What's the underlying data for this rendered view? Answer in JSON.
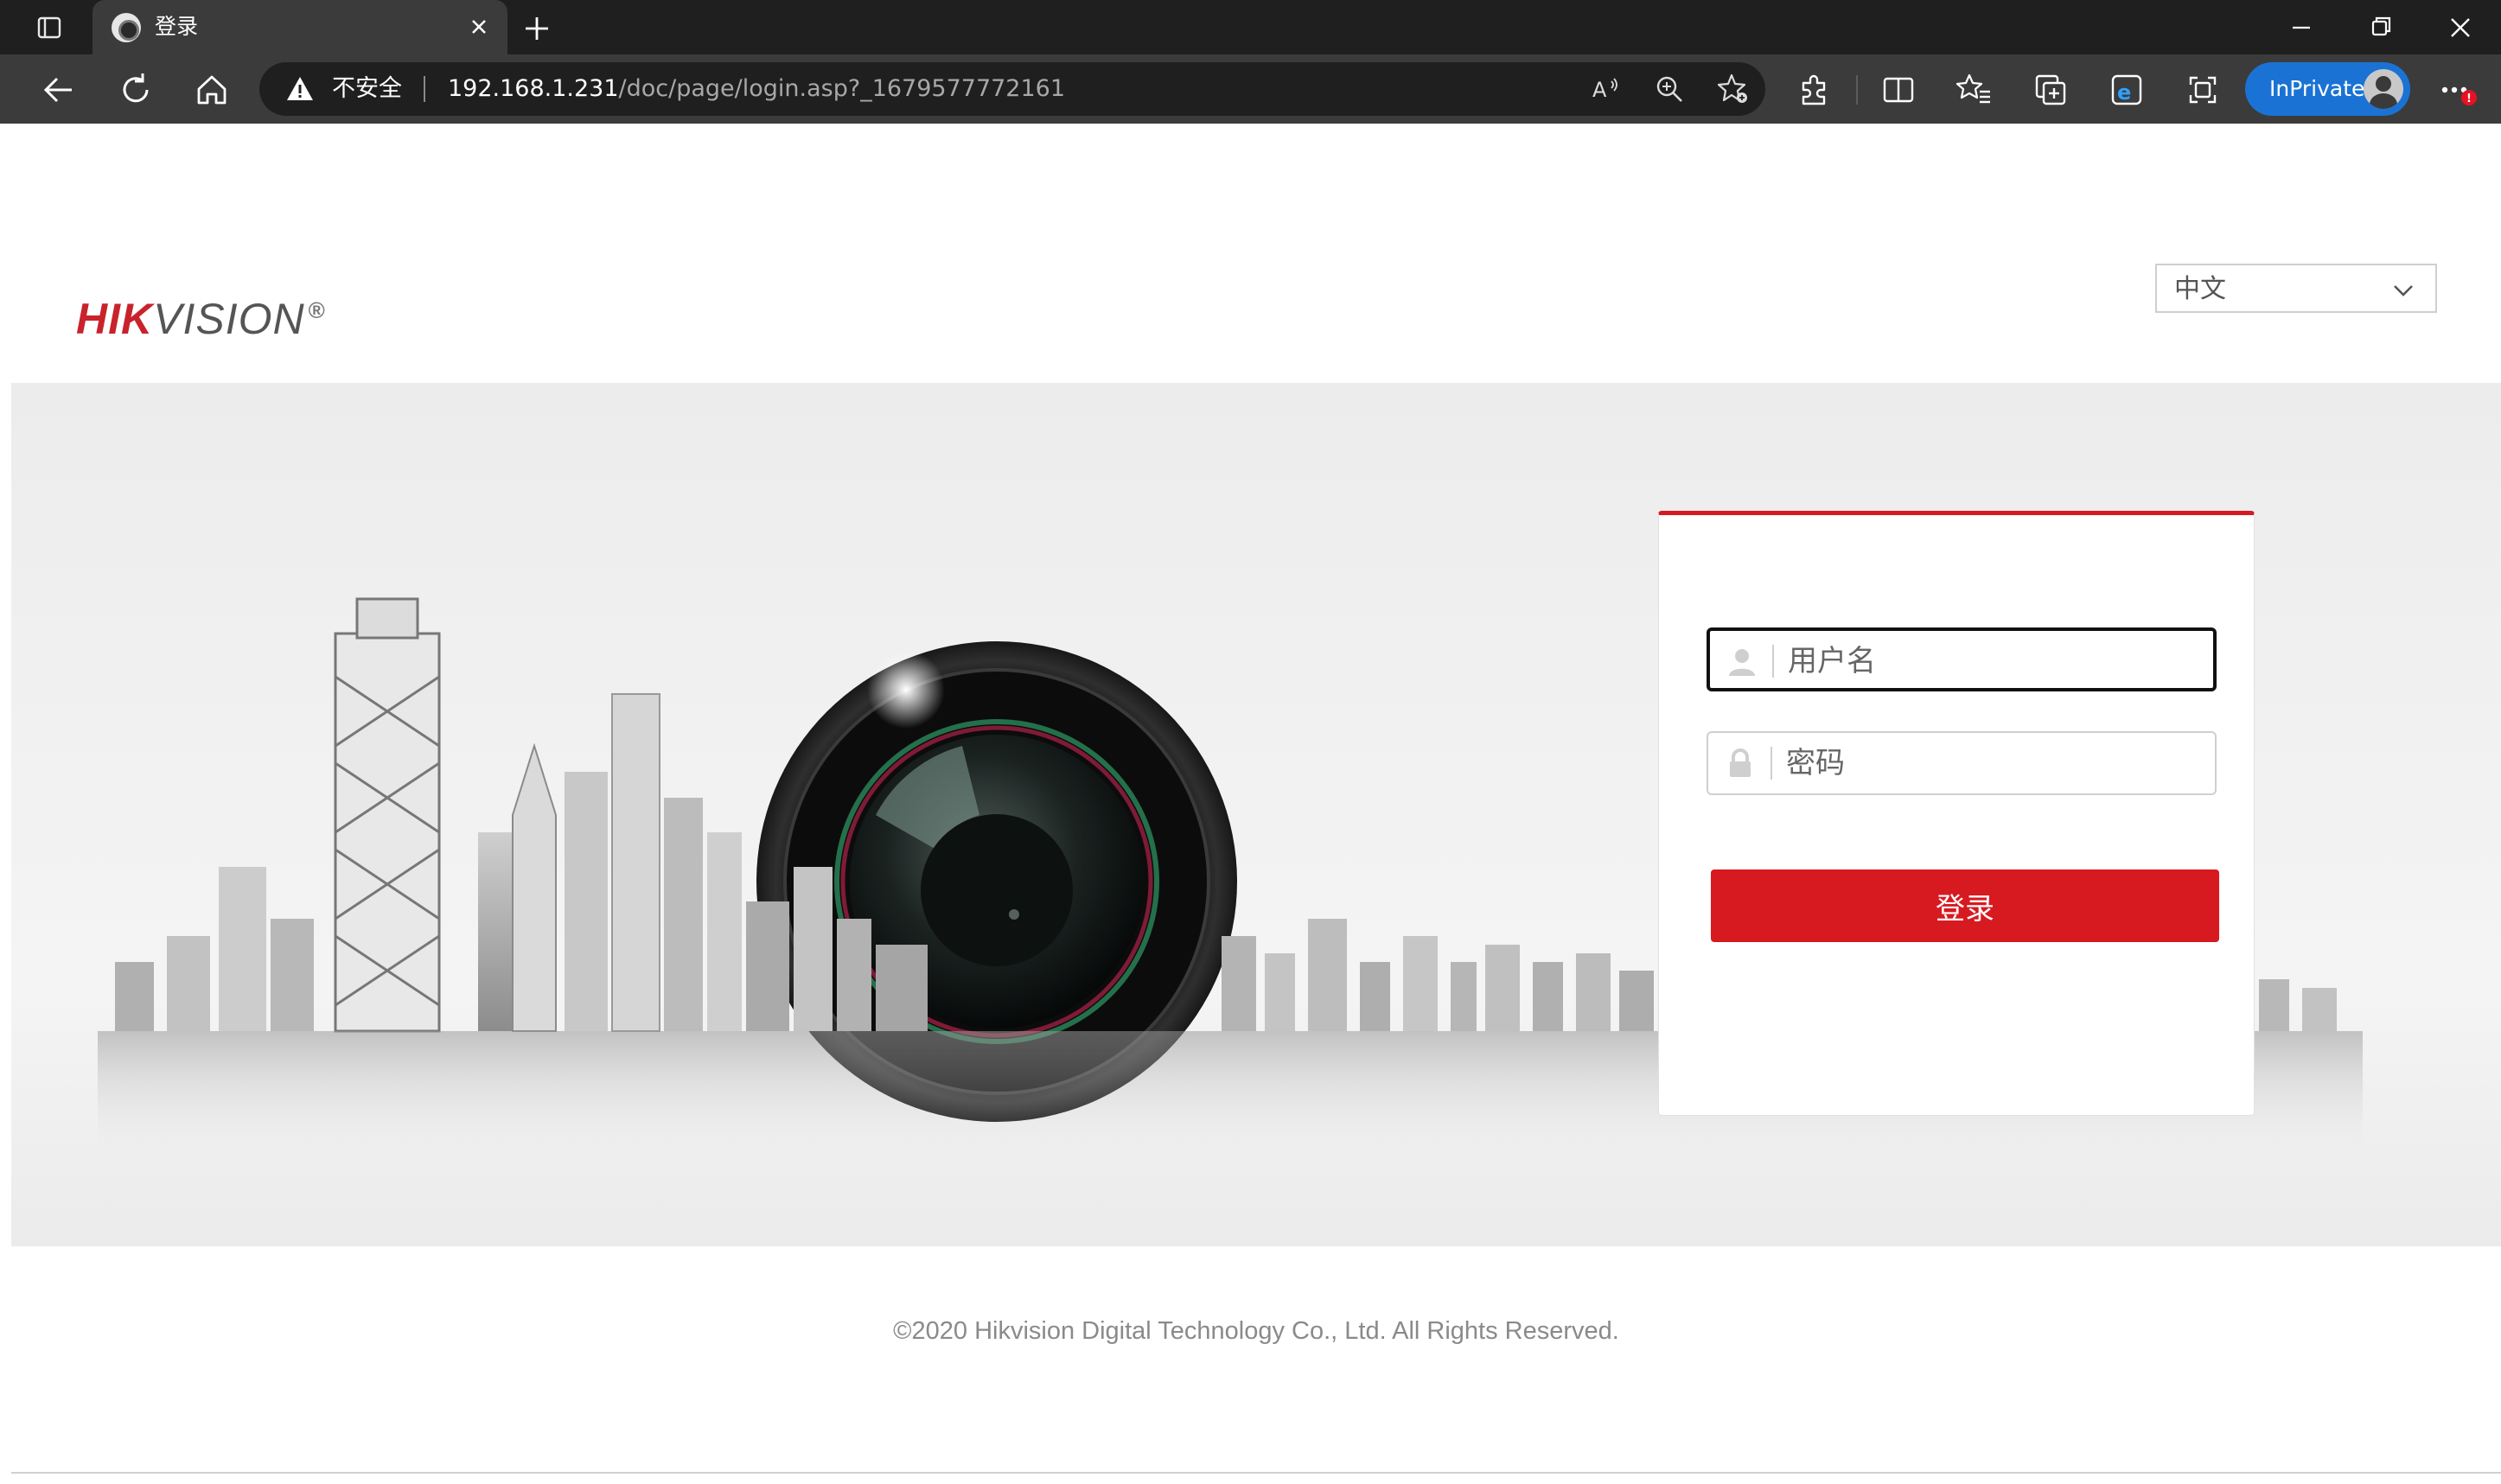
{
  "browser": {
    "tab": {
      "title": "登录",
      "favicon": "hikvision-favicon"
    },
    "address": {
      "security_label": "不安全",
      "url_host": "192.168.1.231",
      "url_path": "/doc/page/login.asp?_1679577772161"
    },
    "inprivate_label": "InPrivate",
    "icons": {
      "tab_actions": "tab-actions-icon",
      "new_tab": "plus-icon",
      "minimize": "minimize-icon",
      "restore": "restore-icon",
      "close": "close-icon",
      "back": "back-arrow-icon",
      "refresh": "refresh-icon",
      "home": "home-icon",
      "read_aloud": "read-aloud-icon",
      "zoom": "zoom-icon",
      "add_favorite": "add-favorite-icon",
      "extensions": "puzzle-icon",
      "split_screen": "split-screen-icon",
      "favorites": "favorites-icon",
      "collections": "collections-icon",
      "ie_mode": "ie-mode-icon",
      "screenshot": "screenshot-icon",
      "more": "ellipsis-icon"
    }
  },
  "header": {
    "logo_text_red": "HIK",
    "logo_text_gray": "VISION",
    "logo_reg": "®",
    "language": {
      "selected": "中文"
    }
  },
  "login": {
    "username_placeholder": "用户名",
    "password_placeholder": "密码",
    "submit_label": "登录"
  },
  "footer": {
    "copyright": "©2020 Hikvision Digital Technology Co., Ltd. All Rights Reserved."
  },
  "colors": {
    "brand_red": "#d71920",
    "inprivate_blue": "#1a73d4"
  }
}
